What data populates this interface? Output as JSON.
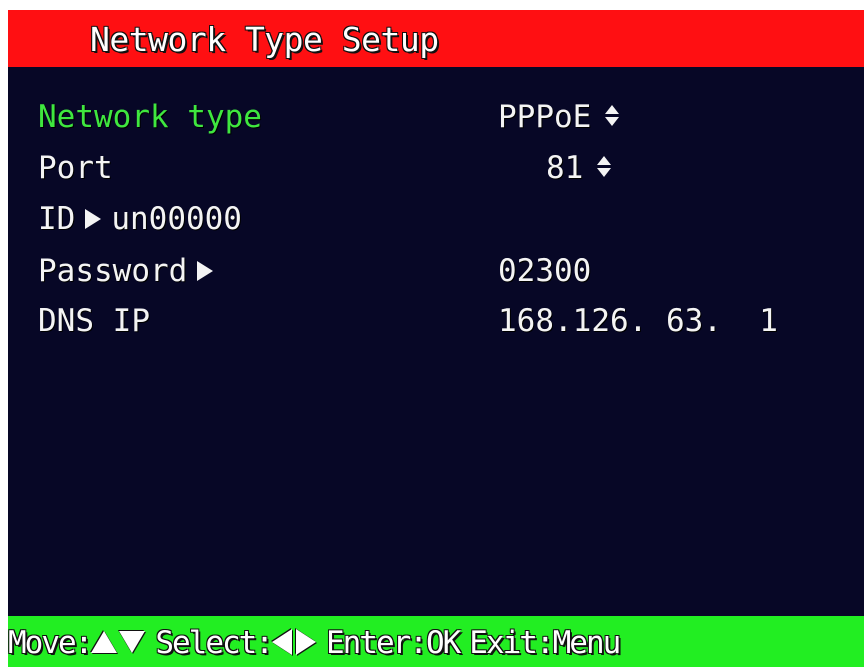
{
  "title": "Network Type Setup",
  "colors": {
    "title_bar": "#ff0f12",
    "background": "#070726",
    "selected_label": "#3fe73f",
    "footer_bar": "#22ee22",
    "text": "#f4f4f4"
  },
  "rows": [
    {
      "label": "Network type",
      "value": "PPPoE",
      "control_icon": "updown-arrows-icon",
      "selected": true
    },
    {
      "label": "Port",
      "value": "81",
      "control_icon": "updown-arrows-icon",
      "selected": false
    },
    {
      "label": "ID",
      "value": "un00000",
      "control_icon": "right-arrow-icon",
      "selected": false
    },
    {
      "label": "Password",
      "value": "02300",
      "control_icon": "right-arrow-icon",
      "selected": false
    },
    {
      "label": "DNS IP",
      "value": "168.126. 63.  1",
      "selected": false
    }
  ],
  "footer": {
    "move_label": "Move:",
    "move_icons": [
      "triangle-up-icon",
      "triangle-down-icon"
    ],
    "select_label": "Select:",
    "select_icons": [
      "triangle-left-icon",
      "triangle-right-icon"
    ],
    "enter_label": "Enter:OK",
    "exit_label": "Exit:Menu"
  }
}
